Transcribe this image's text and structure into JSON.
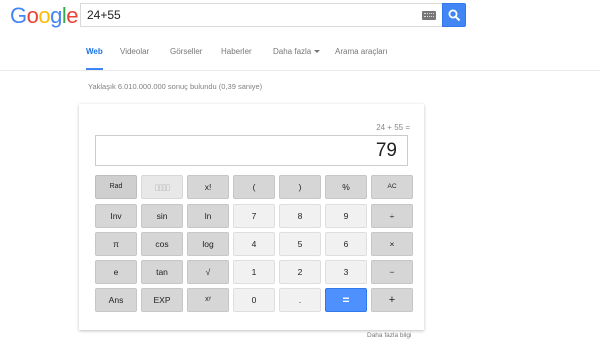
{
  "logo": {
    "text": "Google"
  },
  "search": {
    "value": "24+55"
  },
  "nav": {
    "tabs": [
      {
        "label": "Web",
        "active": true
      },
      {
        "label": "Videolar"
      },
      {
        "label": "Görseller"
      },
      {
        "label": "Haberler"
      },
      {
        "label": "Daha fazla"
      },
      {
        "label": "Arama araçları"
      }
    ]
  },
  "result_stats": "Yaklaşık 6.010.000.000 sonuç bulundu (0,39 saniye)",
  "calculator": {
    "expression": "24 + 55 =",
    "result": "79",
    "keys": [
      [
        "Rad",
        "",
        "x!",
        "(",
        ")",
        "%",
        "AC"
      ],
      [
        "Inv",
        "sin",
        "ln",
        "7",
        "8",
        "9",
        "÷"
      ],
      [
        "π",
        "cos",
        "log",
        "4",
        "5",
        "6",
        "×"
      ],
      [
        "e",
        "tan",
        "√",
        "1",
        "2",
        "3",
        "−"
      ],
      [
        "Ans",
        "EXP",
        "xʸ",
        "0",
        ".",
        "=",
        "+"
      ]
    ],
    "more_info": "Daha fazla bilgi"
  },
  "colors": {
    "accent": "#4285f4",
    "equals_button": "#4d90fe",
    "dark_key": "#d6d6d6",
    "light_key": "#f1f1f1"
  }
}
